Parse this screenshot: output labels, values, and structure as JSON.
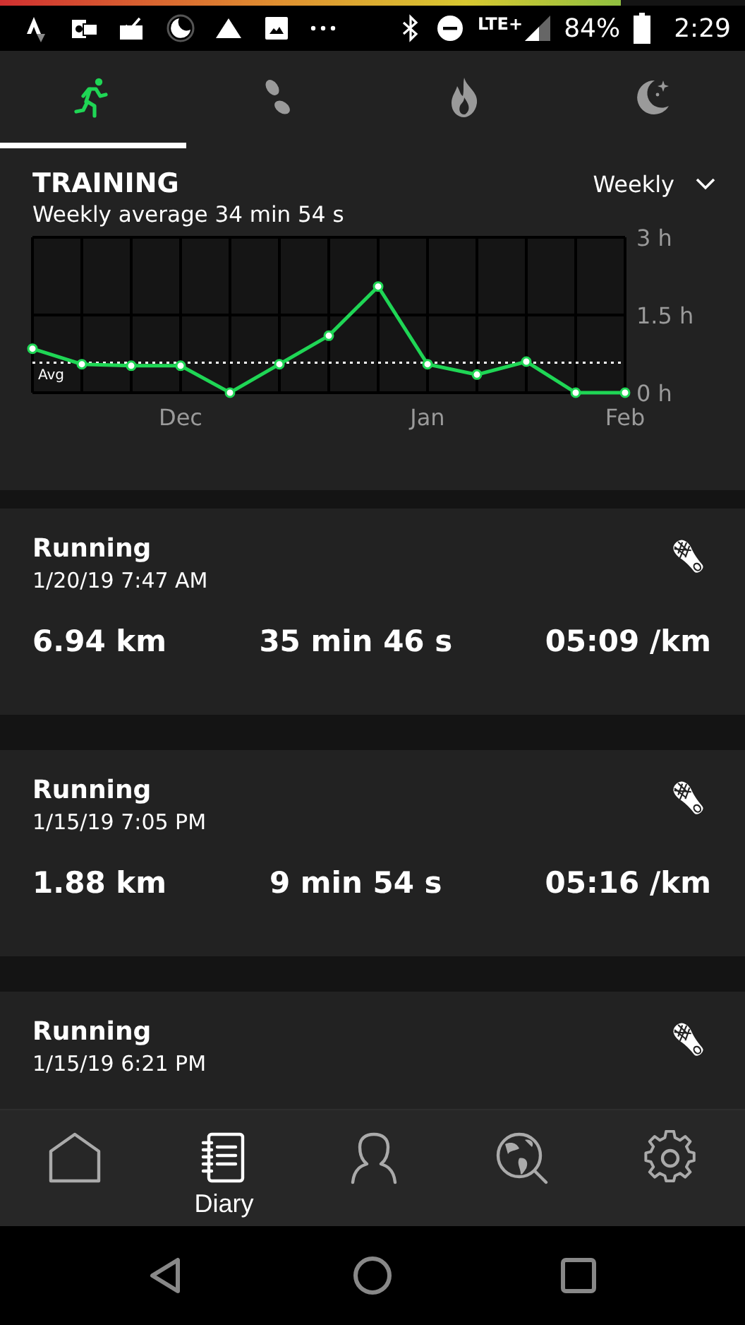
{
  "status_bar": {
    "network": "LTE+",
    "battery": "84%",
    "time": "2:29"
  },
  "tabs": [
    {
      "kind": "running",
      "selected": true
    },
    {
      "kind": "steps",
      "selected": false
    },
    {
      "kind": "calories",
      "selected": false
    },
    {
      "kind": "sleep",
      "selected": false
    }
  ],
  "training": {
    "title": "TRAINING",
    "period": "Weekly",
    "summary": "Weekly average 34 min 54 s",
    "chart_data": {
      "type": "line",
      "categories": [
        null,
        null,
        null,
        "Dec",
        null,
        null,
        null,
        null,
        "Jan",
        null,
        null,
        null,
        "Feb"
      ],
      "series": [
        {
          "color": "#1fd655",
          "marker": "o",
          "values": [
            0.85,
            0.55,
            0.52,
            0.52,
            0,
            0.55,
            1.1,
            2.05,
            0.55,
            0.35,
            0.6,
            0,
            0
          ]
        }
      ],
      "ylim": [
        0,
        3
      ],
      "grid": true,
      "yticks": [
        {
          "value": 0,
          "label": "0 h"
        },
        {
          "value": 1.5,
          "label": "1.5 h"
        },
        {
          "value": 3,
          "label": "3 h"
        }
      ],
      "ref_lines": [
        {
          "axis": "y",
          "value": 0.58,
          "label": "Avg"
        }
      ]
    }
  },
  "activities": [
    {
      "sport": "Running",
      "datetime": "1/20/19 7:47 AM",
      "distance": "6.94 km",
      "duration": "35 min 46 s",
      "pace": "05:09 /km"
    },
    {
      "sport": "Running",
      "datetime": "1/15/19 7:05 PM",
      "distance": "1.88 km",
      "duration": "9 min 54 s",
      "pace": "05:16 /km"
    },
    {
      "sport": "Running",
      "datetime": "1/15/19 6:21 PM"
    }
  ],
  "bottom_nav": [
    {
      "kind": "home",
      "selected": false
    },
    {
      "kind": "diary",
      "label": "Diary",
      "selected": true
    },
    {
      "kind": "profile",
      "selected": false
    },
    {
      "kind": "explore",
      "selected": false
    },
    {
      "kind": "settings",
      "selected": false
    }
  ]
}
